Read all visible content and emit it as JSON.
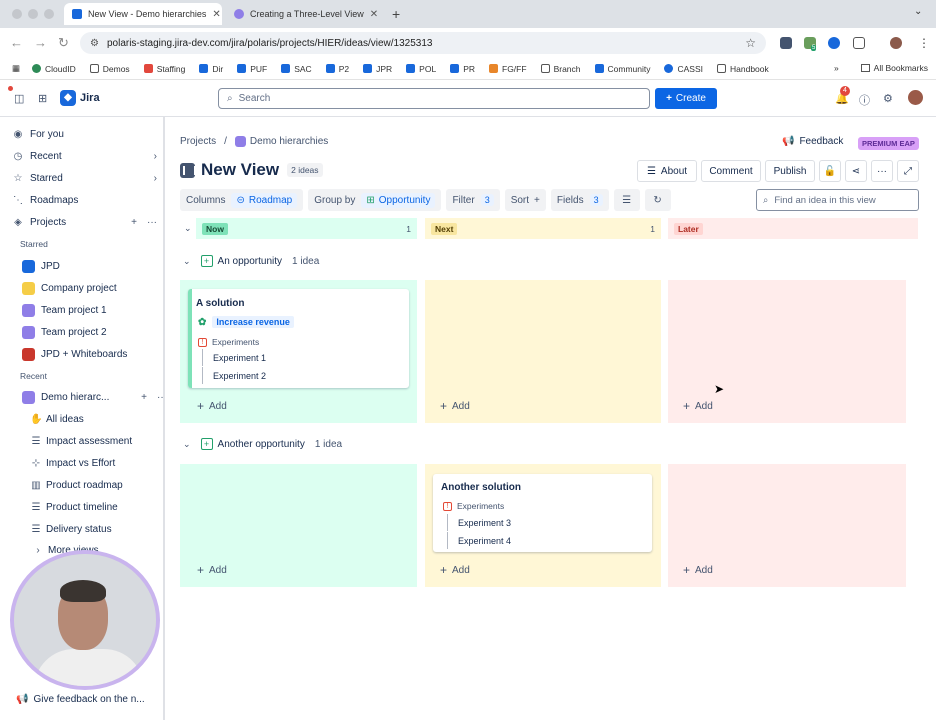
{
  "browser": {
    "tabs": [
      {
        "title": "New View - Demo hierarchies",
        "active": true
      },
      {
        "title": "Creating a Three-Level View",
        "active": false
      }
    ],
    "url": "polaris-staging.jira-dev.com/jira/polaris/projects/HIER/ideas/view/1325313",
    "bookmarks": [
      "CloudID",
      "Demos",
      "Staffing",
      "Dir",
      "PUF",
      "SAC",
      "P2",
      "JPR",
      "POL",
      "PR",
      "FG/FF",
      "Branch",
      "Community",
      "CASSI",
      "Handbook"
    ],
    "bookmarks_more": "»",
    "all_bookmarks": "All Bookmarks",
    "ext_badge": "5"
  },
  "topnav": {
    "app_name": "Jira",
    "search_placeholder": "Search",
    "create_label": "Create",
    "notifications_count": "4"
  },
  "sidebar": {
    "for_you": "For you",
    "recent": "Recent",
    "starred": "Starred",
    "roadmaps": "Roadmaps",
    "projects": "Projects",
    "starred_head": "Starred",
    "starred_projects": [
      "JPD",
      "Company project",
      "Team project 1",
      "Team project 2",
      "JPD + Whiteboards"
    ],
    "recent_head": "Recent",
    "recent_project": "Demo hierarc...",
    "views": [
      "All ideas",
      "Impact assessment",
      "Impact vs Effort",
      "Product roadmap",
      "Product timeline",
      "Delivery status"
    ],
    "more_views": "More views",
    "give_feedback": "Give feedback on the n..."
  },
  "main": {
    "breadcrumb_projects": "Projects",
    "breadcrumb_project": "Demo hierarchies",
    "feedback": "Feedback",
    "premium": "PREMIUM EAP",
    "view_title": "New View",
    "ideas_count": "2 ideas",
    "buttons": {
      "about": "About",
      "comment": "Comment",
      "publish": "Publish"
    },
    "toolbar": {
      "columns": "Columns",
      "columns_value": "Roadmap",
      "group_by": "Group by",
      "group_value": "Opportunity",
      "filter": "Filter",
      "filter_count": "3",
      "sort": "Sort",
      "fields": "Fields",
      "fields_count": "3"
    },
    "find_placeholder": "Find an idea in this view",
    "columns": [
      {
        "label": "Now",
        "count": "1",
        "bg": "#dcfff1",
        "label_bg": "#7ee2b8",
        "label_color": "#164b35"
      },
      {
        "label": "Next",
        "count": "1",
        "bg": "#fff7d6",
        "label_bg": "#f8e6a0",
        "label_color": "#533f04"
      },
      {
        "label": "Later",
        "count": "",
        "bg": "#ffeceb",
        "label_bg": "#ffd5d2",
        "label_color": "#ae2e24"
      }
    ],
    "add_label": "Add",
    "groups": [
      {
        "name": "An opportunity",
        "count": "1 idea",
        "card": {
          "title": "A solution",
          "goal": "Increase revenue",
          "experiments_label": "Experiments",
          "experiments": [
            "Experiment 1",
            "Experiment 2"
          ]
        }
      },
      {
        "name": "Another opportunity",
        "count": "1 idea",
        "card": {
          "title": "Another solution",
          "experiments_label": "Experiments",
          "experiments": [
            "Experiment 3",
            "Experiment 4"
          ]
        }
      }
    ]
  }
}
